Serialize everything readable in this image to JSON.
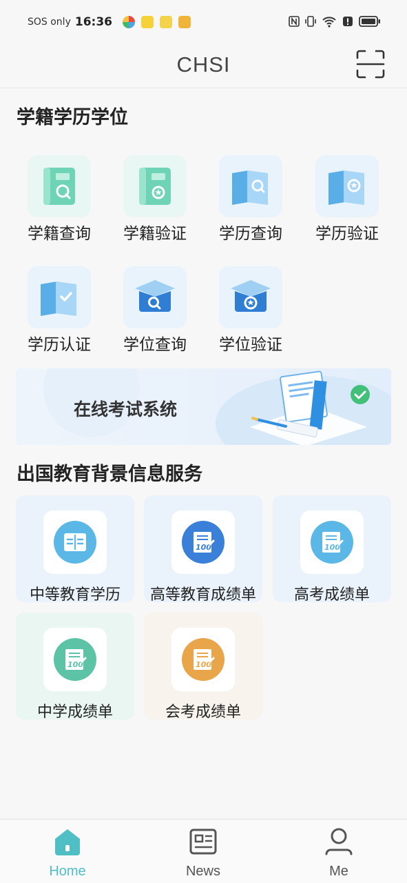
{
  "status_bar": {
    "carrier": "SOS only",
    "time": "16:36"
  },
  "header": {
    "title": "CHSI"
  },
  "section1": {
    "title": "学籍学历学位",
    "items": [
      {
        "label": "学籍查询",
        "icon": "student-record-search-icon"
      },
      {
        "label": "学籍验证",
        "icon": "student-record-verify-icon"
      },
      {
        "label": "学历查询",
        "icon": "education-search-icon"
      },
      {
        "label": "学历验证",
        "icon": "education-verify-icon"
      },
      {
        "label": "学历认证",
        "icon": "education-certify-icon"
      },
      {
        "label": "学位查询",
        "icon": "degree-search-icon"
      },
      {
        "label": "学位验证",
        "icon": "degree-verify-icon"
      }
    ]
  },
  "banner": {
    "text": "在线考试系统"
  },
  "section2": {
    "title": "出国教育背景信息服务",
    "cards": [
      {
        "label": "中等教育学历",
        "icon": "book-icon",
        "color": "#5bb8e6"
      },
      {
        "label": "高等教育成绩单",
        "icon": "transcript-icon",
        "color": "#3a7fd8"
      },
      {
        "label": "高考成绩单",
        "icon": "transcript-icon",
        "color": "#5bb8e6"
      },
      {
        "label": "中学成绩单",
        "icon": "transcript-icon",
        "color": "#5cc3a6"
      },
      {
        "label": "会考成绩单",
        "icon": "transcript-icon",
        "color": "#e8a54a"
      }
    ]
  },
  "bottom_nav": {
    "items": [
      {
        "label": "Home",
        "active": true
      },
      {
        "label": "News",
        "active": false
      },
      {
        "label": "Me",
        "active": false
      }
    ]
  },
  "colors": {
    "accent": "#4fbfc5",
    "green_icon": "#5cc3a6",
    "blue_icon": "#5bb8e6",
    "dark_blue_icon": "#3a7fd8"
  }
}
